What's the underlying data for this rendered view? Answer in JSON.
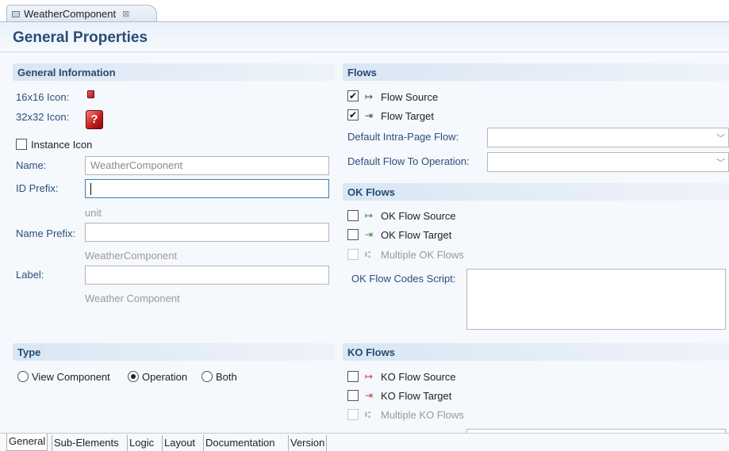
{
  "editor_tab": {
    "title": "WeatherComponent",
    "close_glyph": "⊠"
  },
  "form_title": "General Properties",
  "general_info": {
    "header": "General Information",
    "icon16_label": "16x16 Icon:",
    "icon32_label": "32x32 Icon:",
    "instance_icon_label": "Instance Icon",
    "instance_icon_checked": false,
    "name_label": "Name:",
    "name_value": "WeatherComponent",
    "id_prefix_label": "ID Prefix:",
    "id_prefix_value": "",
    "id_prefix_hint": "unit",
    "name_prefix_label": "Name Prefix:",
    "name_prefix_value": "",
    "name_prefix_hint": "WeatherComponent",
    "label_label": "Label:",
    "label_value": "",
    "label_hint": "Weather Component"
  },
  "flows": {
    "header": "Flows",
    "flow_source_label": "Flow Source",
    "flow_source_checked": true,
    "flow_target_label": "Flow Target",
    "flow_target_checked": true,
    "default_intra_page_label": "Default Intra-Page Flow:",
    "default_intra_page_value": "",
    "default_to_operation_label": "Default Flow To Operation:",
    "default_to_operation_value": ""
  },
  "ok_flows": {
    "header": "OK Flows",
    "source_label": "OK Flow Source",
    "target_label": "OK Flow Target",
    "multiple_label": "Multiple OK Flows",
    "codes_script_label": "OK Flow Codes Script:"
  },
  "type": {
    "header": "Type",
    "options": [
      "View Component",
      "Operation",
      "Both"
    ],
    "selected": "Operation"
  },
  "ko_flows": {
    "header": "KO Flows",
    "source_label": "KO Flow Source",
    "target_label": "KO Flow Target",
    "multiple_label": "Multiple KO Flows"
  },
  "bottom_tabs": [
    "General",
    "Sub-Elements",
    "Logic",
    "Layout",
    "Documentation",
    "Version"
  ],
  "active_bottom_tab": "General",
  "icons": {
    "editor_tab": "component-icon",
    "icon16": "red-cube-icon",
    "icon32": "red-cube-large-icon",
    "flow_source": "arrow-out-icon",
    "flow_target": "arrow-in-icon",
    "multiple_flows": "multi-flow-icon",
    "combo_arrow": "chevron-down-icon"
  },
  "colors": {
    "section_header_text": "#234a76",
    "label_text": "#2c4f7c",
    "title_text": "#2a4d78",
    "ok_icon": "#3a8a2e",
    "ko_icon": "#d03a3a",
    "focus_border": "#3c7fb1"
  }
}
